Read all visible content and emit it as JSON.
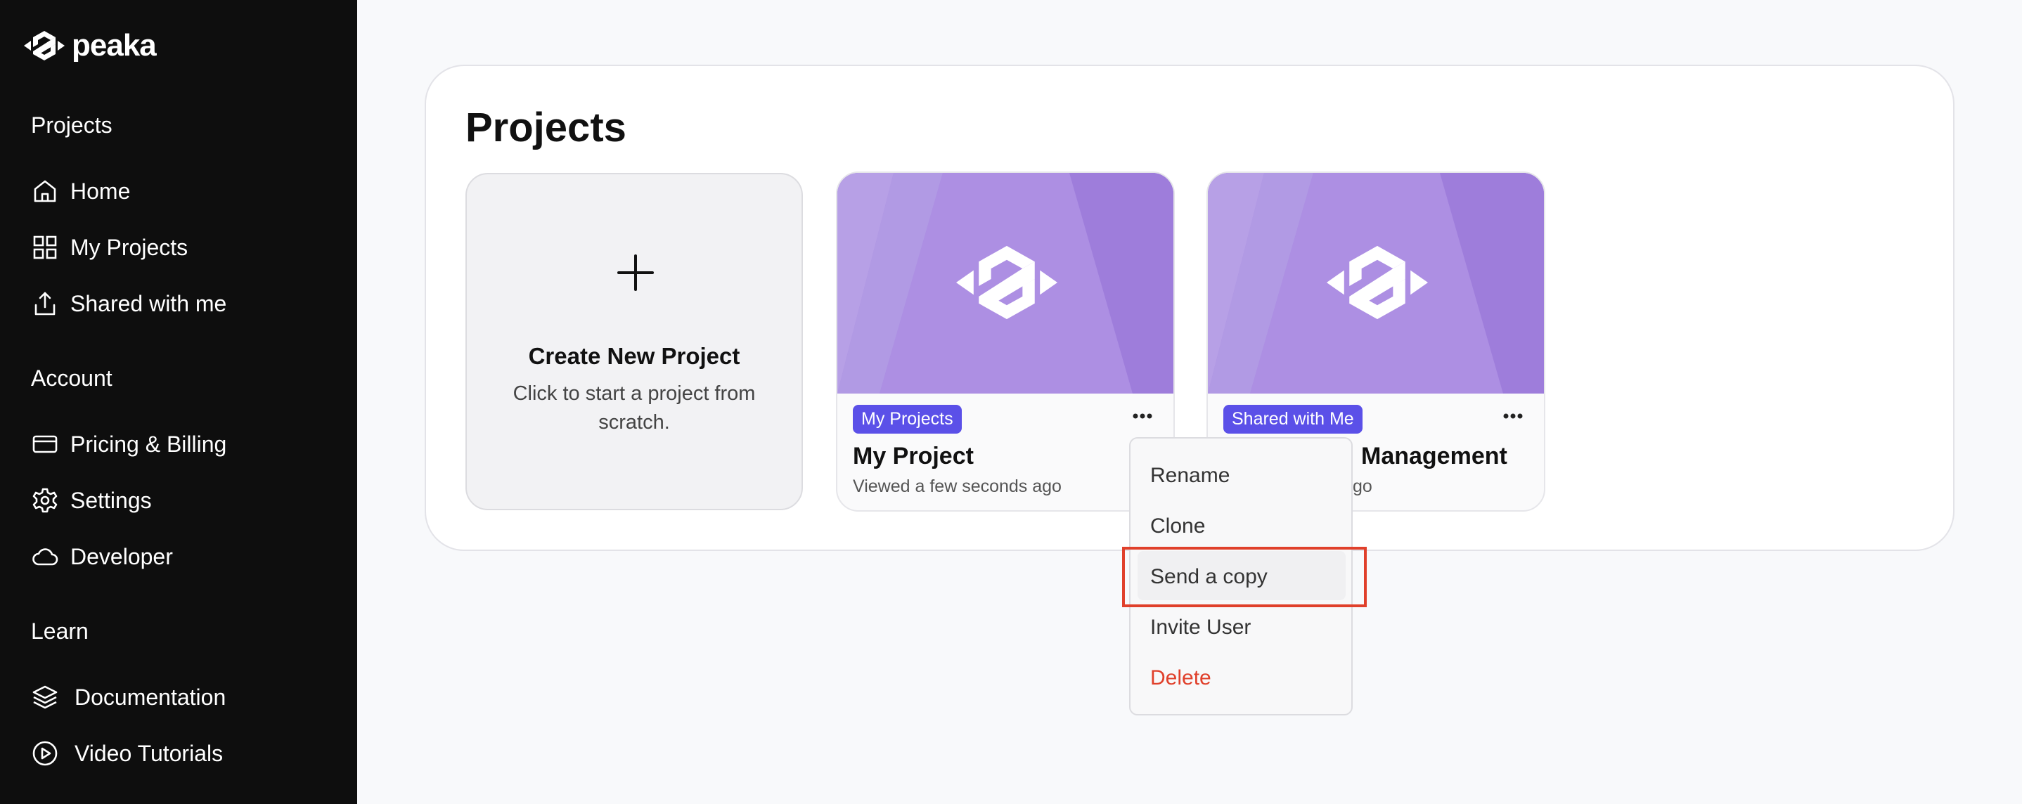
{
  "brand": {
    "name": "peaka"
  },
  "sidebar": {
    "sections": [
      {
        "title": "Projects",
        "items": [
          {
            "label": "Home",
            "icon": "home-icon"
          },
          {
            "label": "My Projects",
            "icon": "grid-icon"
          },
          {
            "label": "Shared with me",
            "icon": "share-icon"
          }
        ]
      },
      {
        "title": "Account",
        "items": [
          {
            "label": "Pricing & Billing",
            "icon": "credit-card-icon"
          },
          {
            "label": "Settings",
            "icon": "gear-icon"
          },
          {
            "label": "Developer",
            "icon": "cloud-icon"
          }
        ]
      },
      {
        "title": "Learn",
        "items": [
          {
            "label": "Documentation",
            "icon": "layers-icon"
          },
          {
            "label": "Video Tutorials",
            "icon": "play-circle-icon"
          }
        ]
      }
    ]
  },
  "main": {
    "title": "Projects",
    "create_card": {
      "title": "Create New Project",
      "description": "Click to start a project from scratch."
    },
    "projects": [
      {
        "badge": "My Projects",
        "name": "My Project",
        "meta": "Viewed a few seconds ago"
      },
      {
        "badge": "Shared with Me",
        "name": "Management",
        "meta": "go"
      }
    ]
  },
  "context_menu": {
    "items": [
      {
        "label": "Rename"
      },
      {
        "label": "Clone"
      },
      {
        "label": "Send a copy",
        "highlighted": true
      },
      {
        "label": "Invite User"
      },
      {
        "label": "Delete",
        "color": "#e0402b"
      }
    ]
  },
  "colors": {
    "sidebar_bg": "#0e0e0e",
    "badge_bg": "#5b50e8",
    "thumb_bg": "#a684df",
    "highlight": "#e0402b"
  }
}
